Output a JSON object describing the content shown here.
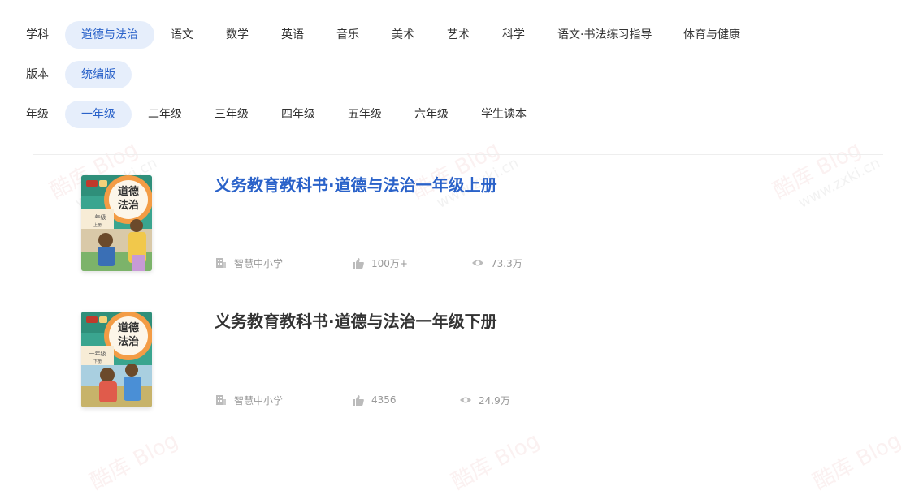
{
  "filters": {
    "subject": {
      "label": "学科",
      "options": [
        "道德与法治",
        "语文",
        "数学",
        "英语",
        "音乐",
        "美术",
        "艺术",
        "科学",
        "语文·书法练习指导",
        "体育与健康"
      ],
      "selected": "道德与法治"
    },
    "edition": {
      "label": "版本",
      "options": [
        "统编版"
      ],
      "selected": "统编版"
    },
    "grade": {
      "label": "年级",
      "options": [
        "一年级",
        "二年级",
        "三年级",
        "四年级",
        "五年级",
        "六年级",
        "学生读本"
      ],
      "selected": "一年级"
    }
  },
  "books": [
    {
      "title": "义务教育教科书·道德与法治一年级上册",
      "publisher": "智慧中小学",
      "likes": "100万+",
      "views": "73.3万",
      "cover_title_top": "道德",
      "cover_title_bottom": "法治",
      "cover_grade": "一年级",
      "cover_volume": "上册"
    },
    {
      "title": "义务教育教科书·道德与法治一年级下册",
      "publisher": "智慧中小学",
      "likes": "4356",
      "views": "24.9万",
      "cover_title_top": "道德",
      "cover_title_bottom": "法治",
      "cover_grade": "一年级",
      "cover_volume": "下册"
    }
  ],
  "watermark": {
    "brand": "酷库 Blog",
    "url": "www.zxki.cn"
  },
  "colors": {
    "accent": "#2a62c9",
    "chip_active_bg": "#e6eefb",
    "muted": "#999999"
  }
}
